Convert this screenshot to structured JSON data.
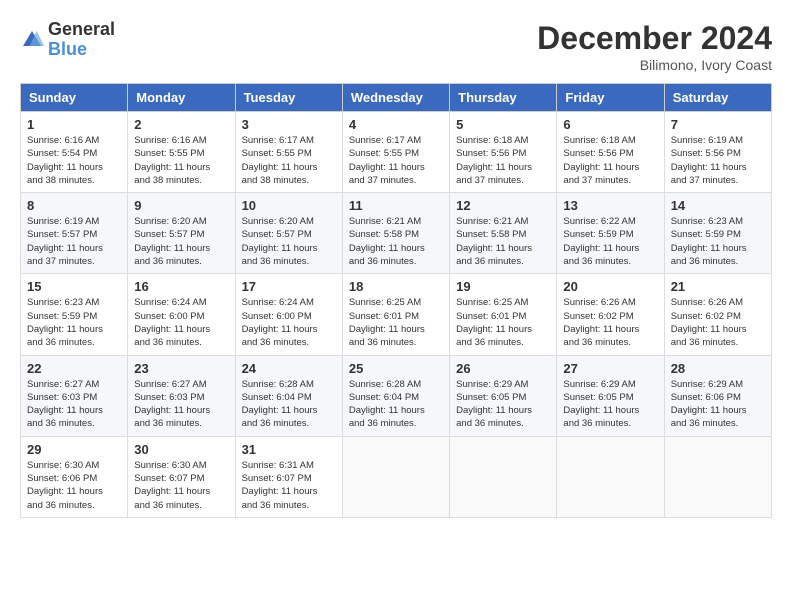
{
  "header": {
    "logo_general": "General",
    "logo_blue": "Blue",
    "month_title": "December 2024",
    "location": "Bilimono, Ivory Coast"
  },
  "calendar": {
    "days_of_week": [
      "Sunday",
      "Monday",
      "Tuesday",
      "Wednesday",
      "Thursday",
      "Friday",
      "Saturday"
    ],
    "weeks": [
      [
        {
          "day": "1",
          "sunrise": "6:16 AM",
          "sunset": "5:54 PM",
          "daylight": "11 hours and 38 minutes."
        },
        {
          "day": "2",
          "sunrise": "6:16 AM",
          "sunset": "5:55 PM",
          "daylight": "11 hours and 38 minutes."
        },
        {
          "day": "3",
          "sunrise": "6:17 AM",
          "sunset": "5:55 PM",
          "daylight": "11 hours and 38 minutes."
        },
        {
          "day": "4",
          "sunrise": "6:17 AM",
          "sunset": "5:55 PM",
          "daylight": "11 hours and 37 minutes."
        },
        {
          "day": "5",
          "sunrise": "6:18 AM",
          "sunset": "5:56 PM",
          "daylight": "11 hours and 37 minutes."
        },
        {
          "day": "6",
          "sunrise": "6:18 AM",
          "sunset": "5:56 PM",
          "daylight": "11 hours and 37 minutes."
        },
        {
          "day": "7",
          "sunrise": "6:19 AM",
          "sunset": "5:56 PM",
          "daylight": "11 hours and 37 minutes."
        }
      ],
      [
        {
          "day": "8",
          "sunrise": "6:19 AM",
          "sunset": "5:57 PM",
          "daylight": "11 hours and 37 minutes."
        },
        {
          "day": "9",
          "sunrise": "6:20 AM",
          "sunset": "5:57 PM",
          "daylight": "11 hours and 36 minutes."
        },
        {
          "day": "10",
          "sunrise": "6:20 AM",
          "sunset": "5:57 PM",
          "daylight": "11 hours and 36 minutes."
        },
        {
          "day": "11",
          "sunrise": "6:21 AM",
          "sunset": "5:58 PM",
          "daylight": "11 hours and 36 minutes."
        },
        {
          "day": "12",
          "sunrise": "6:21 AM",
          "sunset": "5:58 PM",
          "daylight": "11 hours and 36 minutes."
        },
        {
          "day": "13",
          "sunrise": "6:22 AM",
          "sunset": "5:59 PM",
          "daylight": "11 hours and 36 minutes."
        },
        {
          "day": "14",
          "sunrise": "6:23 AM",
          "sunset": "5:59 PM",
          "daylight": "11 hours and 36 minutes."
        }
      ],
      [
        {
          "day": "15",
          "sunrise": "6:23 AM",
          "sunset": "5:59 PM",
          "daylight": "11 hours and 36 minutes."
        },
        {
          "day": "16",
          "sunrise": "6:24 AM",
          "sunset": "6:00 PM",
          "daylight": "11 hours and 36 minutes."
        },
        {
          "day": "17",
          "sunrise": "6:24 AM",
          "sunset": "6:00 PM",
          "daylight": "11 hours and 36 minutes."
        },
        {
          "day": "18",
          "sunrise": "6:25 AM",
          "sunset": "6:01 PM",
          "daylight": "11 hours and 36 minutes."
        },
        {
          "day": "19",
          "sunrise": "6:25 AM",
          "sunset": "6:01 PM",
          "daylight": "11 hours and 36 minutes."
        },
        {
          "day": "20",
          "sunrise": "6:26 AM",
          "sunset": "6:02 PM",
          "daylight": "11 hours and 36 minutes."
        },
        {
          "day": "21",
          "sunrise": "6:26 AM",
          "sunset": "6:02 PM",
          "daylight": "11 hours and 36 minutes."
        }
      ],
      [
        {
          "day": "22",
          "sunrise": "6:27 AM",
          "sunset": "6:03 PM",
          "daylight": "11 hours and 36 minutes."
        },
        {
          "day": "23",
          "sunrise": "6:27 AM",
          "sunset": "6:03 PM",
          "daylight": "11 hours and 36 minutes."
        },
        {
          "day": "24",
          "sunrise": "6:28 AM",
          "sunset": "6:04 PM",
          "daylight": "11 hours and 36 minutes."
        },
        {
          "day": "25",
          "sunrise": "6:28 AM",
          "sunset": "6:04 PM",
          "daylight": "11 hours and 36 minutes."
        },
        {
          "day": "26",
          "sunrise": "6:29 AM",
          "sunset": "6:05 PM",
          "daylight": "11 hours and 36 minutes."
        },
        {
          "day": "27",
          "sunrise": "6:29 AM",
          "sunset": "6:05 PM",
          "daylight": "11 hours and 36 minutes."
        },
        {
          "day": "28",
          "sunrise": "6:29 AM",
          "sunset": "6:06 PM",
          "daylight": "11 hours and 36 minutes."
        }
      ],
      [
        {
          "day": "29",
          "sunrise": "6:30 AM",
          "sunset": "6:06 PM",
          "daylight": "11 hours and 36 minutes."
        },
        {
          "day": "30",
          "sunrise": "6:30 AM",
          "sunset": "6:07 PM",
          "daylight": "11 hours and 36 minutes."
        },
        {
          "day": "31",
          "sunrise": "6:31 AM",
          "sunset": "6:07 PM",
          "daylight": "11 hours and 36 minutes."
        },
        null,
        null,
        null,
        null
      ]
    ]
  }
}
